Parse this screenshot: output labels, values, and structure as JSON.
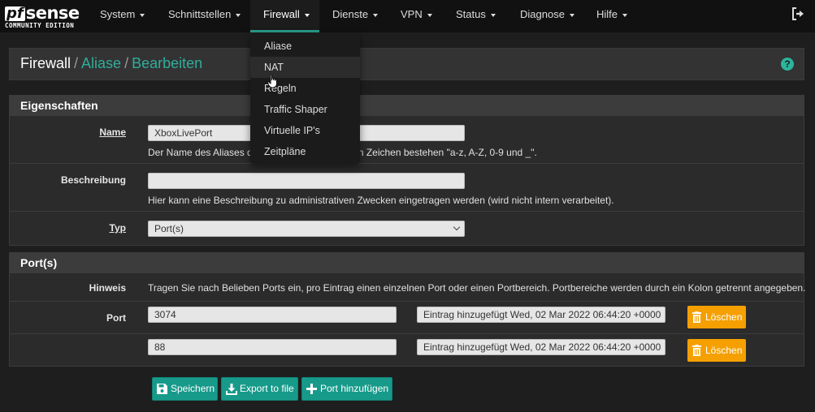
{
  "brand": {
    "logo_mark": "pf",
    "logo_word": "sense",
    "edition": "COMMUNITY EDITION"
  },
  "nav": {
    "items": [
      {
        "label": "System"
      },
      {
        "label": "Schnittstellen"
      },
      {
        "label": "Firewall"
      },
      {
        "label": "Dienste"
      },
      {
        "label": "VPN"
      },
      {
        "label": "Status"
      },
      {
        "label": "Diagnose"
      },
      {
        "label": "Hilfe"
      }
    ],
    "active": "Firewall",
    "logout_icon": "logout-icon"
  },
  "dropdown": {
    "items": [
      {
        "label": "Aliase"
      },
      {
        "label": "NAT"
      },
      {
        "label": "Regeln"
      },
      {
        "label": "Traffic Shaper"
      },
      {
        "label": "Virtuelle IP's"
      },
      {
        "label": "Zeitpläne"
      }
    ],
    "hovered": "NAT"
  },
  "breadcrumb": {
    "root": "Firewall",
    "sep": "/",
    "level1": "Aliase",
    "level2": "Bearbeiten",
    "help_icon": "?"
  },
  "properties": {
    "title": "Eigenschaften",
    "name_label": "Name",
    "name_value": "XboxLivePort",
    "name_help": "Der Name des Aliases darf nur aus den folgenden Zeichen bestehen \"a-z, A-Z, 0-9 und _\".",
    "desc_label": "Beschreibung",
    "desc_value": "",
    "desc_help": "Hier kann eine Beschreibung zu administrativen Zwecken eingetragen werden (wird nicht intern verarbeitet).",
    "type_label": "Typ",
    "type_value": "Port(s)"
  },
  "ports": {
    "title": "Port(s)",
    "hint_label": "Hinweis",
    "hint_text": "Tragen Sie nach Belieben Ports ein, pro Eintrag einen einzelnen Port oder einen Portbereich. Portbereiche werden durch ein Kolon getrennt angegeben.",
    "port_label": "Port",
    "entries": [
      {
        "port": "3074",
        "desc": "Eintrag hinzugefügt Wed, 02 Mar 2022 06:44:20 +0000",
        "delete": "Löschen"
      },
      {
        "port": "88",
        "desc": "Eintrag hinzugefügt Wed, 02 Mar 2022 06:44:20 +0000",
        "delete": "Löschen"
      }
    ]
  },
  "actions": {
    "save": "Speichern",
    "export": "Export to file",
    "add_port": "Port hinzufügen"
  },
  "colors": {
    "accent": "#179a8a",
    "link": "#2fae9c",
    "delete": "#f5a000",
    "navbar": "#111111"
  }
}
